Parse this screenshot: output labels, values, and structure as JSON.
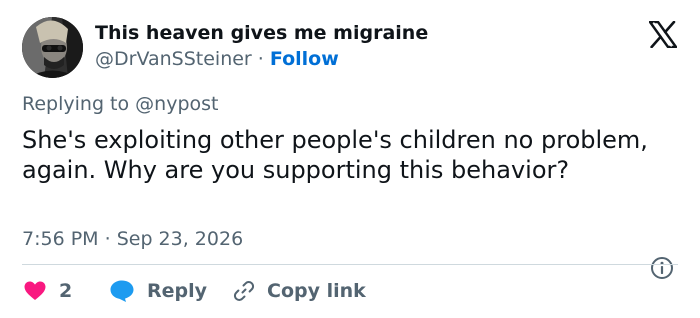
{
  "author": {
    "display_name": "This heaven gives me migraine",
    "handle": "@DrVanSSteiner",
    "separator": "·",
    "follow_label": "Follow"
  },
  "reply_context": {
    "prefix": "Replying to",
    "mention": "@nypost"
  },
  "tweet": {
    "text": "She's exploiting other people's children no problem, again. Why are you supporting this behavior?",
    "time": "7:56 PM",
    "separator": "·",
    "date": "Sep 23, 2026"
  },
  "actions": {
    "like_count": "2",
    "reply_label": "Reply",
    "copy_link_label": "Copy link"
  },
  "icons": {
    "logo": "x-logo-icon",
    "info": "info-icon",
    "like": "heart-icon",
    "reply": "speech-bubble-icon",
    "copy": "link-icon"
  },
  "colors": {
    "text": "#0f1419",
    "secondary": "#536471",
    "follow": "#006fd6",
    "like": "#f91880",
    "reply_bubble": "#1d9bf0",
    "divider": "#cfd9de"
  }
}
